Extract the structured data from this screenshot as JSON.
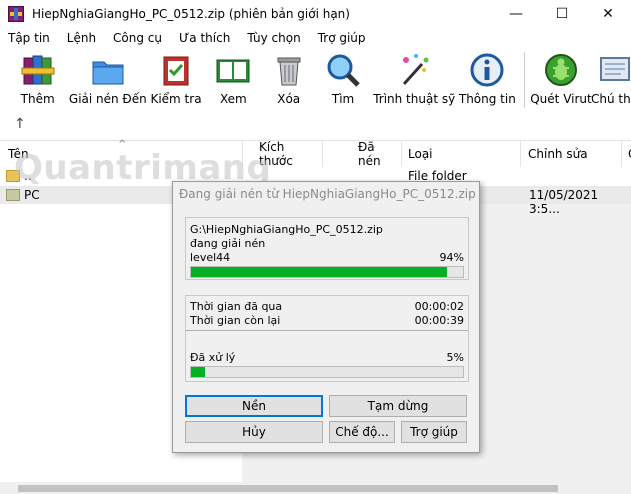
{
  "window": {
    "title": "HiepNghiaGiangHo_PC_0512.zip (phiên bản giới hạn)",
    "minimize_glyph": "—",
    "maximize_glyph": "☐",
    "close_glyph": "✕"
  },
  "menu": {
    "items": [
      "Tập tin",
      "Lệnh",
      "Công cụ",
      "Ưa thích",
      "Tùy chọn",
      "Trợ giúp"
    ]
  },
  "toolbar": {
    "buttons": [
      {
        "label": "Thêm",
        "icon": "add-books-icon"
      },
      {
        "label": "Giải nén Đến",
        "icon": "extract-folder-icon"
      },
      {
        "label": "Kiểm tra",
        "icon": "test-clipboard-icon"
      },
      {
        "label": "Xem",
        "icon": "view-book-icon"
      },
      {
        "label": "Xóa",
        "icon": "trash-icon"
      },
      {
        "label": "Tìm",
        "icon": "magnifier-icon"
      },
      {
        "label": "Trình thuật sỹ",
        "icon": "wizard-wand-icon"
      },
      {
        "label": "Thông tin",
        "icon": "info-icon"
      },
      {
        "label": "Quét Virut",
        "icon": "virus-scan-icon"
      },
      {
        "label": "Chú th",
        "icon": "comment-icon"
      }
    ]
  },
  "nav": {
    "up_glyph": "↑",
    "sort_glyph": "^"
  },
  "list": {
    "columns": [
      "Tên",
      "Kích thước",
      "Đã nén",
      "Loại",
      "Chỉnh sửa",
      "C"
    ],
    "rows": [
      {
        "name": "..",
        "type": "File folder",
        "date": ""
      },
      {
        "name": "PC",
        "type": "",
        "date": "11/05/2021 3:5..."
      }
    ]
  },
  "watermark": "Quantrimang",
  "dialog": {
    "title": "Đang giải nén từ HiepNghiaGiangHo_PC_0512.zip",
    "archive_path": "G:\\HiepNghiaGiangHo_PC_0512.zip",
    "status": "đang giải nén",
    "current_item": "level44",
    "current_percent": "94%",
    "current_progress": 0.94,
    "elapsed_label": "Thời gian đã qua",
    "elapsed_value": "00:00:02",
    "remaining_label": "Thời gian còn lại",
    "remaining_value": "00:00:39",
    "processed_label": "Đã xử lý",
    "processed_percent": "5%",
    "processed_progress": 0.05,
    "buttons": {
      "background": "Nền",
      "pause": "Tạm dừng",
      "cancel": "Hủy",
      "mode": "Chế độ...",
      "help": "Trợ giúp"
    }
  }
}
